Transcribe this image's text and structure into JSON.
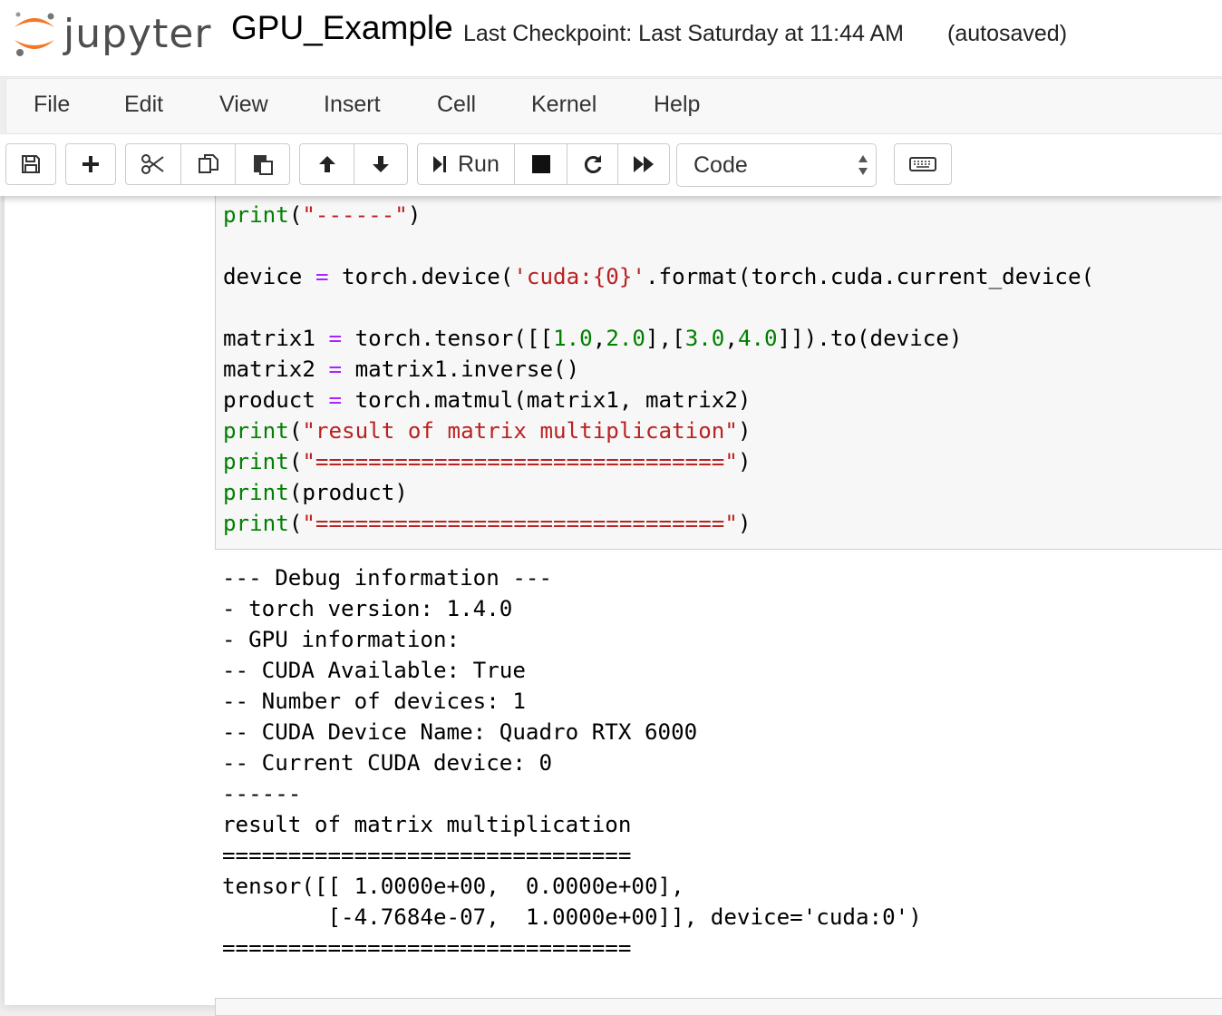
{
  "header": {
    "logo_text": "jupyter",
    "notebook_name": "GPU_Example",
    "checkpoint": "Last Checkpoint: Last Saturday at 11:44 AM",
    "autosave_status": "(autosaved)"
  },
  "menubar": {
    "items": [
      "File",
      "Edit",
      "View",
      "Insert",
      "Cell",
      "Kernel",
      "Help"
    ]
  },
  "toolbar": {
    "run_label": "Run",
    "cell_type": "Code",
    "icons": [
      "save-icon",
      "plus-icon",
      "cut-icon",
      "copy-icon",
      "paste-icon",
      "arrow-up-icon",
      "arrow-down-icon",
      "step-forward-icon",
      "stop-icon",
      "restart-icon",
      "fast-forward-icon",
      "keyboard-icon"
    ]
  },
  "cell": {
    "code_lines": [
      "print(\"------\")",
      "",
      "device = torch.device('cuda:{0}'.format(torch.cuda.current_device(",
      "",
      "matrix1 = torch.tensor([[1.0,2.0],[3.0,4.0]]).to(device)",
      "matrix2 = matrix1.inverse()",
      "product = torch.matmul(matrix1, matrix2)",
      "print(\"result of matrix multiplication\")",
      "print(\"===============================\")",
      "print(product)",
      "print(\"===============================\")"
    ],
    "output_lines": [
      "--- Debug information ---",
      "- torch version: 1.4.0",
      "- GPU information:",
      "-- CUDA Available: True",
      "-- Number of devices: 1",
      "-- CUDA Device Name: Quadro RTX 6000",
      "-- Current CUDA device: 0",
      "------",
      "result of matrix multiplication",
      "===============================",
      "tensor([[ 1.0000e+00,  0.0000e+00],",
      "        [-4.7684e-07,  1.0000e+00]], device='cuda:0')",
      "==============================="
    ]
  },
  "colors": {
    "keyword": "#008000",
    "string": "#ba2121",
    "number": "#008000",
    "operator": "#aa22ff",
    "logo_orange": "#f37726"
  }
}
